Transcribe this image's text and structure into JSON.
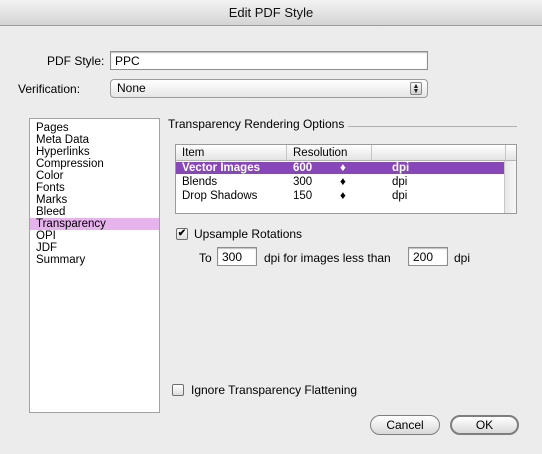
{
  "window": {
    "title": "Edit PDF Style"
  },
  "pdf_style": {
    "label": "PDF Style:",
    "value": "PPC"
  },
  "verification": {
    "label": "Verification:",
    "value": "None"
  },
  "categories": [
    "Pages",
    "Meta Data",
    "Hyperlinks",
    "Compression",
    "Color",
    "Fonts",
    "Marks",
    "Bleed",
    "Transparency",
    "OPI",
    "JDF",
    "Summary"
  ],
  "selected_category": "Transparency",
  "group": {
    "title": "Transparency Rendering Options"
  },
  "table": {
    "columns": [
      "Item",
      "Resolution"
    ],
    "rows": [
      {
        "item": "Vector Images",
        "value": "600",
        "stepper": "♦",
        "unit": "dpi",
        "selected": true
      },
      {
        "item": "Blends",
        "value": "300",
        "stepper": "♦",
        "unit": "dpi",
        "selected": false
      },
      {
        "item": "Drop Shadows",
        "value": "150",
        "stepper": "♦",
        "unit": "dpi",
        "selected": false
      }
    ]
  },
  "upsample": {
    "checkbox_label": "Upsample Rotations",
    "checked": true,
    "check_glyph": "✔",
    "to_label": "To",
    "to_value": "300",
    "middle_label": "dpi for images less than",
    "less_value": "200",
    "unit_label": "dpi"
  },
  "ignore": {
    "checkbox_label": "Ignore Transparency Flattening",
    "checked": false
  },
  "buttons": {
    "cancel": "Cancel",
    "ok": "OK"
  },
  "colors": {
    "selection_row": "#8847b8",
    "selection_list": "#e6b3ec"
  }
}
